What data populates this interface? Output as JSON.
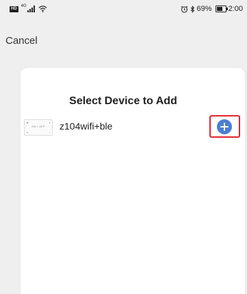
{
  "status_bar": {
    "hd_badge": "HD",
    "network_type": "4G",
    "battery_percent": "69%",
    "battery_level": 0.69,
    "time": "2:00",
    "alarm_icon": "alarm-icon",
    "bluetooth_icon": "bluetooth-icon",
    "battery_icon": "battery-icon",
    "signal_icon": "signal-icon",
    "wifi_icon": "wifi-icon"
  },
  "header": {
    "cancel_label": "Cancel"
  },
  "card": {
    "title": "Select Device to Add",
    "devices": [
      {
        "name": "z104wifi+ble",
        "thumbnail_label": "ON • OFF",
        "add_icon": "plus-circle-icon"
      }
    ]
  },
  "colors": {
    "accent": "#4b7fd2",
    "highlight": "#e02530",
    "background": "#efefef",
    "card": "#ffffff"
  }
}
